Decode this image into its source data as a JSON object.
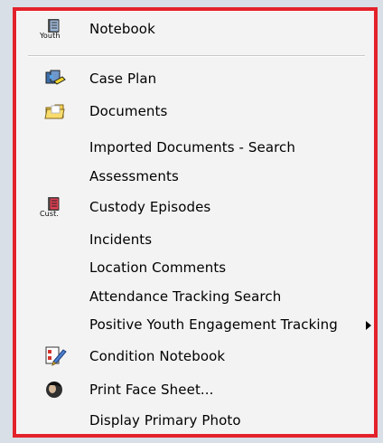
{
  "menu": {
    "items": [
      {
        "label": "Notebook",
        "icon": "youth-notebook-icon",
        "icon_text": "Youth"
      },
      {
        "label": "Case Plan",
        "icon": "case-plan-icon"
      },
      {
        "label": "Documents",
        "icon": "documents-folder-icon"
      },
      {
        "label": "Imported Documents - Search"
      },
      {
        "label": "Assessments"
      },
      {
        "label": "Custody Episodes",
        "icon": "custody-notebook-icon",
        "icon_text": "Cust."
      },
      {
        "label": "Incidents"
      },
      {
        "label": "Location Comments"
      },
      {
        "label": "Attendance Tracking Search"
      },
      {
        "label": "Positive Youth Engagement Tracking",
        "submenu_indicator": "right-arrow"
      },
      {
        "label": "Condition Notebook",
        "icon": "condition-notebook-icon"
      },
      {
        "label": "Print Face Sheet...",
        "icon": "print-face-sheet-icon"
      },
      {
        "label": "Display Primary Photo"
      }
    ]
  },
  "colors": {
    "highlight_border": "#e3222b",
    "menu_background": "#f3f3f3",
    "page_background": "#d9dfe6"
  }
}
